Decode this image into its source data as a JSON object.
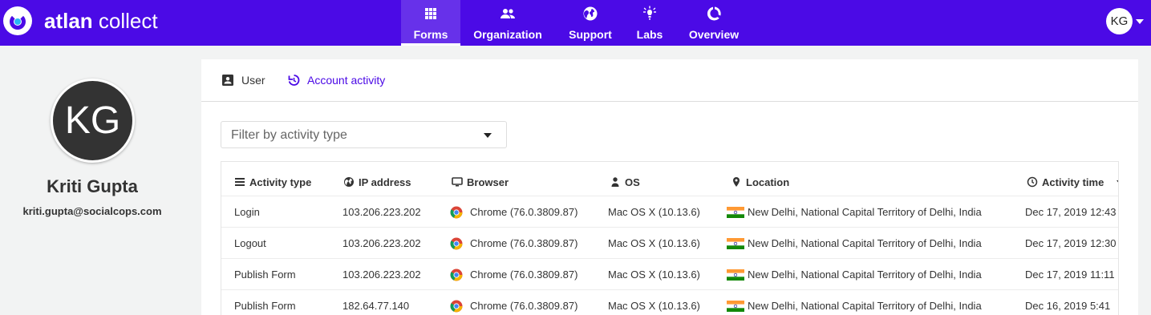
{
  "app": {
    "brand_bold": "atlan",
    "brand_light": " collect"
  },
  "nav": [
    {
      "label": "Forms",
      "icon": "grid-icon"
    },
    {
      "label": "Organization",
      "icon": "people-icon"
    },
    {
      "label": "Support",
      "icon": "globe-icon"
    },
    {
      "label": "Labs",
      "icon": "bulb-icon"
    },
    {
      "label": "Overview",
      "icon": "donut-icon"
    }
  ],
  "user": {
    "initials": "KG"
  },
  "profile": {
    "initials": "KG",
    "name": "Kriti Gupta",
    "email": "kriti.gupta@socialcops.com"
  },
  "tabs": {
    "user": "User",
    "activity": "Account activity"
  },
  "filter": {
    "placeholder": "Filter by activity type"
  },
  "table": {
    "headers": [
      "Activity type",
      "IP address",
      "Browser",
      "OS",
      "Location",
      "Activity time"
    ],
    "rows": [
      {
        "activity": "Login",
        "ip": "103.206.223.202",
        "browser": "Chrome (76.0.3809.87)",
        "os": "Mac OS X (10.13.6)",
        "location": "New Delhi, National Capital Territory of Delhi, India",
        "time": "Dec 17, 2019 12:43"
      },
      {
        "activity": "Logout",
        "ip": "103.206.223.202",
        "browser": "Chrome (76.0.3809.87)",
        "os": "Mac OS X (10.13.6)",
        "location": "New Delhi, National Capital Territory of Delhi, India",
        "time": "Dec 17, 2019 12:30"
      },
      {
        "activity": "Publish Form",
        "ip": "103.206.223.202",
        "browser": "Chrome (76.0.3809.87)",
        "os": "Mac OS X (10.13.6)",
        "location": "New Delhi, National Capital Territory of Delhi, India",
        "time": "Dec 17, 2019 11:11"
      },
      {
        "activity": "Publish Form",
        "ip": "182.64.77.140",
        "browser": "Chrome (76.0.3809.87)",
        "os": "Mac OS X (10.13.6)",
        "location": "New Delhi, National Capital Territory of Delhi, India",
        "time": "Dec 16, 2019 5:41"
      }
    ]
  },
  "colors": {
    "accent": "#4b0ae6",
    "background": "#f2f3f3"
  }
}
